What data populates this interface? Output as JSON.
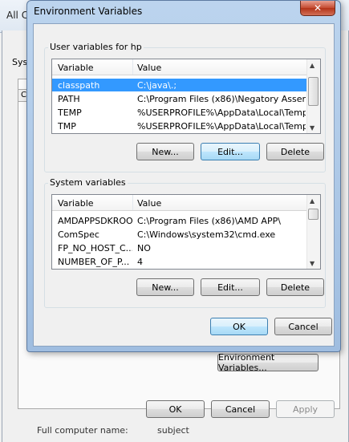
{
  "background": {
    "top_text": "All C",
    "sysprop_tab": "Syst",
    "sysprop_inner_label": "C",
    "bottom_left_text": "Full computer name:",
    "bottom_right_text": "subject",
    "env_button": "Environment Variables...",
    "ok": "OK",
    "cancel": "Cancel",
    "apply": "Apply"
  },
  "dialog": {
    "title": "Environment Variables",
    "close": "✕",
    "user_group": "User variables for hp",
    "system_group": "System variables",
    "col_variable": "Variable",
    "col_value": "Value",
    "user_rows": [
      {
        "name": "classpath",
        "value": "C:\\java\\.;"
      },
      {
        "name": "PATH",
        "value": "C:\\Program Files (x86)\\Negatory Assem..."
      },
      {
        "name": "TEMP",
        "value": "%USERPROFILE%\\AppData\\Local\\Temp"
      },
      {
        "name": "TMP",
        "value": "%USERPROFILE%\\AppData\\Local\\Temp"
      }
    ],
    "system_rows": [
      {
        "name": "AMDAPPSDKROOT",
        "value": "C:\\Program Files (x86)\\AMD APP\\"
      },
      {
        "name": "ComSpec",
        "value": "C:\\Windows\\system32\\cmd.exe"
      },
      {
        "name": "FP_NO_HOST_C...",
        "value": "NO"
      },
      {
        "name": "NUMBER_OF_P...",
        "value": "4"
      }
    ],
    "new": "New...",
    "edit": "Edit...",
    "delete": "Delete",
    "ok": "OK",
    "cancel": "Cancel"
  }
}
